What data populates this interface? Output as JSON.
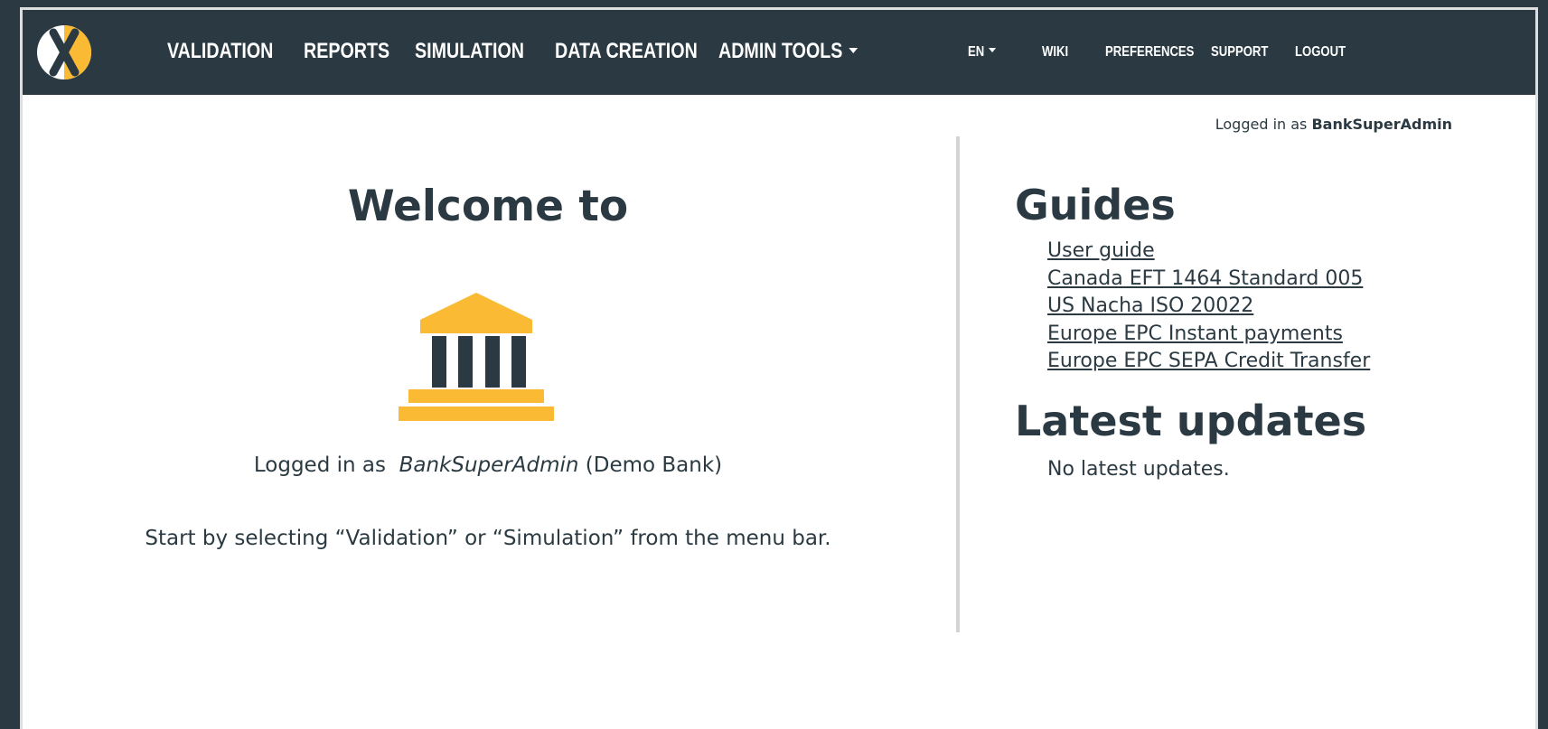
{
  "nav": {
    "main": [
      {
        "label": "VALIDATION"
      },
      {
        "label": "REPORTS"
      },
      {
        "label": "SIMULATION"
      },
      {
        "label": "DATA CREATION"
      },
      {
        "label": "ADMIN TOOLS",
        "dropdown": true
      }
    ],
    "secondary": {
      "language": "EN",
      "wiki": "WIKI",
      "preferences": "PREFERENCES",
      "support": "SUPPORT",
      "logout": "LOGOUT"
    }
  },
  "header_login": {
    "prefix": "Logged in as",
    "user": "BankSuperAdmin"
  },
  "welcome": {
    "title": "Welcome to",
    "icon": "bank-icon",
    "login_prefix": "Logged in as",
    "user": "BankSuperAdmin",
    "org": "(Demo Bank)",
    "hint": "Start by selecting “Validation” or “Simulation” from the menu bar."
  },
  "guides": {
    "title": "Guides",
    "items": [
      {
        "label": "User guide"
      },
      {
        "label": "Canada EFT 1464 Standard 005"
      },
      {
        "label": "US Nacha ISO 20022"
      },
      {
        "label": "Europe EPC Instant payments"
      },
      {
        "label": "Europe EPC SEPA Credit Transfer"
      }
    ]
  },
  "updates": {
    "title": "Latest updates",
    "empty_text": "No latest updates."
  },
  "colors": {
    "nav_bg": "#2b3a42",
    "accent": "#fbba33",
    "text": "#2b3a42",
    "divider": "#d4d4d4"
  }
}
